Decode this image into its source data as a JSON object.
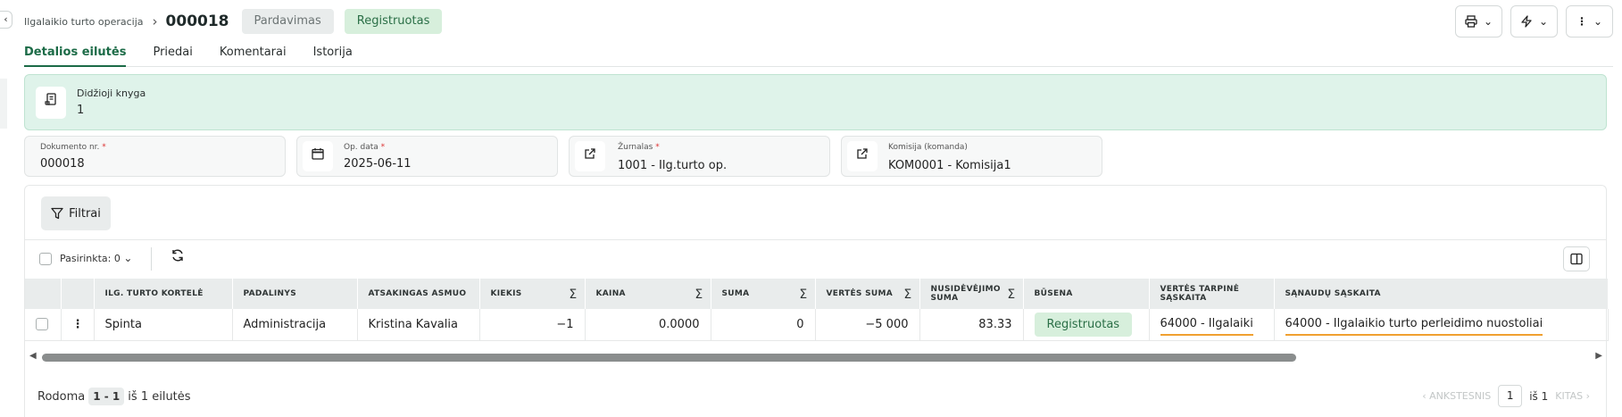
{
  "header": {
    "breadcrumb": "Ilgalaikio turto operacija",
    "doc_number": "000018",
    "type_badge": "Pardavimas",
    "status_badge": "Registruotas"
  },
  "tabs": [
    {
      "label": "Detalios eilutės",
      "active": true
    },
    {
      "label": "Priedai",
      "active": false
    },
    {
      "label": "Komentarai",
      "active": false
    },
    {
      "label": "Istorija",
      "active": false
    }
  ],
  "ledger": {
    "title": "Didžioji knyga",
    "value": "1"
  },
  "fields": {
    "doc_no": {
      "label": "Dokumento nr.",
      "value": "000018"
    },
    "op_date": {
      "label": "Op. data",
      "value": "2025-06-11"
    },
    "journal": {
      "label": "Žurnalas",
      "value": "1001 - Ilg.turto op."
    },
    "commission": {
      "label": "Komisija (komanda)",
      "value": "KOM0001 - Komisija1"
    }
  },
  "toolbar": {
    "filters_label": "Filtrai",
    "selected_label": "Pasirinkta: 0"
  },
  "table": {
    "headers": {
      "card": "ILG. TURTO KORTELĖ",
      "dept": "PADALINYS",
      "person": "ATSAKINGAS ASMUO",
      "qty": "KIEKIS",
      "price": "KAINA",
      "sum": "SUMA",
      "value_sum": "VERTĖS SUMA",
      "depr_sum": "NUSIDĖVĖJIMO SUMA",
      "state": "BŪSENA",
      "value_acc": "VERTĖS TARPINĖ SĄSKAITA",
      "cost_acc": "SĄNAUDŲ SĄSKAITA"
    },
    "rows": [
      {
        "card": "Spinta",
        "dept": "Administracija",
        "person": "Kristina Kavalia",
        "qty": "−1",
        "price": "0.0000",
        "sum": "0",
        "value_sum": "−5 000",
        "depr_sum": "83.33",
        "state": "Registruotas",
        "value_acc": "64000 - Ilgalaiki",
        "cost_acc": "64000 - Ilgalaikio turto perleidimo nuostoliai"
      }
    ]
  },
  "footer": {
    "shown_label": "Rodoma",
    "range": "1 - 1",
    "of_rows": "iš 1 eilutės",
    "prev_label": "ANKSTESNIS",
    "page": "1",
    "of_pages": "iš 1",
    "next_label": "KITAS"
  },
  "colors": {
    "accent": "#1c6b47",
    "success_bg": "#d7efdc",
    "ledger_bg": "#dff3ea",
    "highlight": "#f0a030"
  }
}
